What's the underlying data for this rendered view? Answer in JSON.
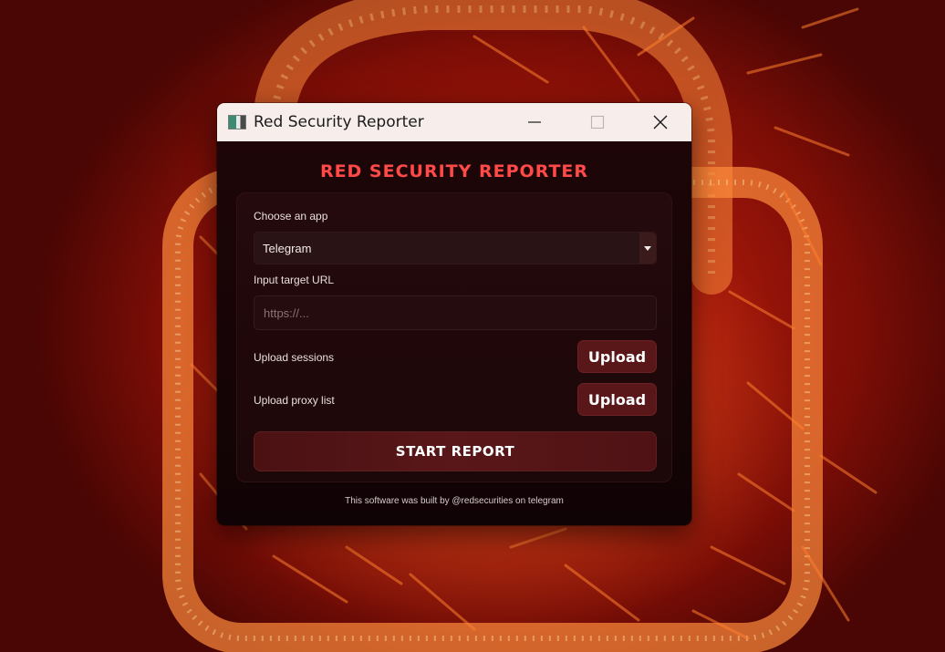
{
  "window": {
    "title": "Red Security Reporter",
    "icon": "app-window-icon"
  },
  "window_controls": {
    "minimize_icon": "minimize-icon",
    "maximize_icon": "maximize-icon",
    "close_icon": "close-icon"
  },
  "app": {
    "heading": "RED SECURITY REPORTER",
    "accent_color": "#ff4a48",
    "button_color": "#5a1719",
    "background_color": "#170406"
  },
  "form": {
    "app_select": {
      "label": "Choose an app",
      "value": "Telegram"
    },
    "target_url": {
      "label": "Input target URL",
      "placeholder": "https://...",
      "value": ""
    },
    "sessions": {
      "label": "Upload sessions",
      "button_label": "Upload"
    },
    "proxy": {
      "label": "Upload proxy list",
      "button_label": "Upload"
    },
    "start_button_label": "START REPORT"
  },
  "footer": {
    "text": "This software was built by @redsecurities on telegram"
  }
}
